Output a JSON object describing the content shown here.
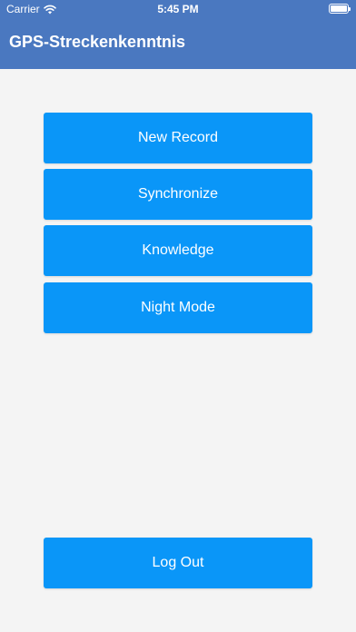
{
  "status_bar": {
    "carrier": "Carrier",
    "time": "5:45 PM",
    "battery_level": 1.0,
    "wifi_icon": "wifi-icon",
    "battery_icon": "battery-icon"
  },
  "header": {
    "title": "GPS-Streckenkenntnis",
    "background_color": "#4a78c0"
  },
  "menu": {
    "new_record": "New Record",
    "synchronize": "Synchronize",
    "knowledge": "Knowledge",
    "night_mode": "Night Mode"
  },
  "footer": {
    "log_out": "Log Out"
  },
  "colors": {
    "button": "#0a96f8",
    "background": "#f4f4f4"
  }
}
